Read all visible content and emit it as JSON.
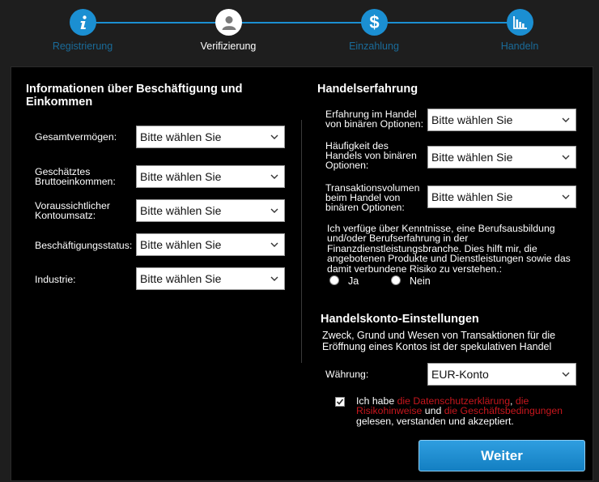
{
  "stepper": {
    "steps": [
      {
        "label": "Registrierung",
        "icon": "info-icon"
      },
      {
        "label": "Verifizierung",
        "icon": "user-icon"
      },
      {
        "label": "Einzahlung",
        "icon": "dollar-icon"
      },
      {
        "label": "Handeln",
        "icon": "chart-icon"
      }
    ],
    "active_step": 2,
    "accent_color": "#1b8fd2"
  },
  "employment": {
    "title": "Informationen über Beschäftigung und Einkommen",
    "fields": [
      {
        "label": "Gesamtvermögen:",
        "value": "Bitte wählen Sie"
      },
      {
        "label": "Geschätztes Bruttoeinkommen:",
        "value": "Bitte wählen Sie"
      },
      {
        "label": "Voraussichtlicher Kontoumsatz:",
        "value": "Bitte wählen Sie"
      },
      {
        "label": "Beschäftigungsstatus:",
        "value": "Bitte wählen Sie"
      },
      {
        "label": "Industrie:",
        "value": "Bitte wählen Sie"
      }
    ]
  },
  "experience": {
    "title": "Handelserfahrung",
    "fields": [
      {
        "label": "Erfahrung im Handel von binären Optionen:",
        "value": "Bitte wählen Sie"
      },
      {
        "label": "Häufigkeit des Handels von binären Optionen:",
        "value": "Bitte wählen Sie"
      },
      {
        "label": "Transaktionsvolumen beim Handel von binären Optionen:",
        "value": "Bitte wählen Sie"
      }
    ],
    "knowledge_text": "Ich verfüge über Kenntnisse, eine Berufsausbildung und/oder Berufserfahrung in der Finanzdienstleistungsbranche. Dies hilft mir, die angebotenen Produkte und Dienstleistungen sowie das damit verbundene Risiko zu verstehen.:",
    "yes_label": "Ja",
    "no_label": "Nein"
  },
  "account": {
    "title": "Handelskonto-Einstellungen",
    "description": "Zweck, Grund und Wesen von Transaktionen für die Eröffnung eines Kontos ist der spekulativen Handel",
    "currency_label": "Währung:",
    "currency_value": "EUR-Konto",
    "consent": {
      "checked": true,
      "prefix": "Ich habe ",
      "link1": "die Datenschutzerklärung",
      "sep1": ", ",
      "link2": "die Risikohinweise",
      "mid": " und ",
      "link3": "die Geschäftsbedingungen",
      "suffix": " gelesen, verstanden und akzeptiert.",
      "link_color": "#c8161d"
    }
  },
  "submit_label": "Weiter"
}
